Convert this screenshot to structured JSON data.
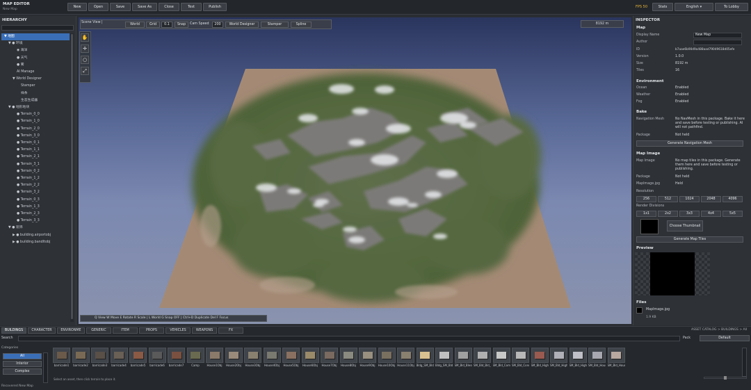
{
  "app": {
    "title": "MAP EDITOR",
    "subtitle": "New Map"
  },
  "toolbar": {
    "new": "New",
    "open": "Open",
    "save": "Save",
    "save_as": "Save As",
    "close": "Close",
    "test": "Test",
    "publish": "Publish"
  },
  "topright": {
    "fps": "FPS 50",
    "stats": "Stats",
    "language": "English ▾",
    "lobby": "To Lobby"
  },
  "hierarchy": {
    "title": "HIERARCHY",
    "rows": [
      {
        "label": "▼  地图",
        "indent": 4,
        "sel": true
      },
      {
        "label": "▼ ●  环境",
        "indent": 10
      },
      {
        "label": "◉  海洋",
        "indent": 22
      },
      {
        "label": "●  天气",
        "indent": 22
      },
      {
        "label": "●  雾",
        "indent": 22
      },
      {
        "label": "AI Manage",
        "indent": 22
      },
      {
        "label": "▼  World Designer",
        "indent": 16
      },
      {
        "label": "Stamper",
        "indent": 28
      },
      {
        "label": "样条",
        "indent": 28
      },
      {
        "label": "生态生成器",
        "indent": 28
      },
      {
        "label": "▼ ●  地形地块",
        "indent": 10
      },
      {
        "label": "●  Terrain_0_0",
        "indent": 22
      },
      {
        "label": "●  Terrain_1_0",
        "indent": 22
      },
      {
        "label": "●  Terrain_2_0",
        "indent": 22
      },
      {
        "label": "●  Terrain_3_0",
        "indent": 22
      },
      {
        "label": "●  Terrain_0_1",
        "indent": 22
      },
      {
        "label": "●  Terrain_1_1",
        "indent": 22
      },
      {
        "label": "●  Terrain_2_1",
        "indent": 22
      },
      {
        "label": "●  Terrain_3_1",
        "indent": 22
      },
      {
        "label": "●  Terrain_0_2",
        "indent": 22
      },
      {
        "label": "●  Terrain_1_2",
        "indent": 22
      },
      {
        "label": "●  Terrain_2_2",
        "indent": 22
      },
      {
        "label": "●  Terrain_3_2",
        "indent": 22
      },
      {
        "label": "●  Terrain_0_3",
        "indent": 22
      },
      {
        "label": "●  Terrain_1_3",
        "indent": 22
      },
      {
        "label": "●  Terrain_2_3",
        "indent": 22
      },
      {
        "label": "●  Terrain_3_3",
        "indent": 22
      },
      {
        "label": "▼ ●  装饰",
        "indent": 10
      },
      {
        "label": "▶ ●  building.airportobj",
        "indent": 16
      },
      {
        "label": "▶ ●  building.bandltobj",
        "indent": 16
      }
    ]
  },
  "viewport": {
    "scene_view": "Scene View  |",
    "world": "World",
    "grid": "Grid",
    "grid_value": "0.1",
    "snap": "Snap",
    "cam_speed": "Cam Speed",
    "cam_value": "200",
    "world_designer": "World Designer",
    "stamper": "Stamper",
    "spline": "Spline",
    "distance": "8192 m",
    "hints": "Q View  W Move  E Rotate  R Scale  |  L World  G Snap OFF  |  Ctrl+D Duplicate  Del  F Focus"
  },
  "inspector": {
    "title": "INSPECTOR",
    "map_head": "Map",
    "display_name_label": "Display Name",
    "display_name_value": "New Map",
    "author_label": "Author",
    "author_value": "",
    "id_label": "ID",
    "id_value": "b7aae6b90d9a488aad79049618d05efe",
    "version_label": "Version",
    "version_value": "1.0.0",
    "size_label": "Size",
    "size_value": "8192 m",
    "tiles_label": "Tiles",
    "tiles_value": "16",
    "env_head": "Environment",
    "ocean_label": "Ocean",
    "ocean_value": "Enabled",
    "weather_label": "Weather",
    "weather_value": "Enabled",
    "fog_label": "Fog",
    "fog_value": "Enabled",
    "bake_head": "Bake",
    "navmesh_label": "Navigation Mesh",
    "navmesh_value": "No NavMesh in this package. Bake it here and save before testing or publishing. AI will not pathfind.",
    "package_label": "Package",
    "package_value": "Not held",
    "gen_nav_btn": "Generate Navigation Mesh",
    "mapimage_head": "Map Image",
    "mapimage_label": "Map Image",
    "mapimage_value": "No map tiles in this package. Generate them here and save before testing or publishing.",
    "package2_label": "Package",
    "package2_value": "Not held",
    "mapimagejpg_label": "MapImage.jpg",
    "mapimagejpg_value": "Held",
    "resolution_label": "Resolution",
    "resolutions": [
      "256",
      "512",
      "1024",
      "2048",
      "4096"
    ],
    "render_div_label": "Render Divisions",
    "divisions": [
      "1x1",
      "2x2",
      "3x3",
      "4x4",
      "5x5"
    ],
    "choose_thumb": "Choose Thumbnail",
    "gen_tiles_btn": "Generate Map Tiles",
    "preview_head": "Preview",
    "files_head": "Files",
    "file_name": "MapImage.jpg",
    "file_size": "1.9 KB"
  },
  "bottom": {
    "tabs": [
      "BUILDINGS",
      "CHARACTER",
      "ENVIRONME",
      "GENERIC",
      "ITEM",
      "PROPS",
      "VEHICLES",
      "WEAPONS",
      "FX"
    ],
    "breadcrumb": "ASSET CATALOG  >  BUILDINGS  >  All",
    "search_label": "Search",
    "pack_label": "Pack",
    "pack_value": "Default",
    "categories_label": "Categories",
    "categories": [
      "All",
      "Interior",
      "Complex"
    ],
    "select_hint": "Select an asset, then click terrain to place it.",
    "status": "Recovered New Map",
    "assets": [
      "barricade1",
      "barricade2",
      "barricade3",
      "barricade4",
      "barricade5",
      "barricade6",
      "barricade7",
      "Camp",
      "House1Obj",
      "House2Obj",
      "House3Obj",
      "House4Obj",
      "House5Obj",
      "House6Obj",
      "House7Obj",
      "House8Obj",
      "House9Obj",
      "House10Obj",
      "House11Obj",
      "Bldg_SM_Bld_Afric",
      "Bldg_SM_Bld_Awning",
      "SM_Bld_Blessing",
      "SM_Bld_Bld_Conn",
      "SM_Bld_Comp",
      "SM_Bld_Connect",
      "SM_Bld_HighRise_Lar",
      "SM_Bld_HighRise_Lg",
      "SM_Bld_HighRise_Med",
      "SM_Bld_Housing",
      "SM_Bld_Housing_Sm"
    ]
  }
}
